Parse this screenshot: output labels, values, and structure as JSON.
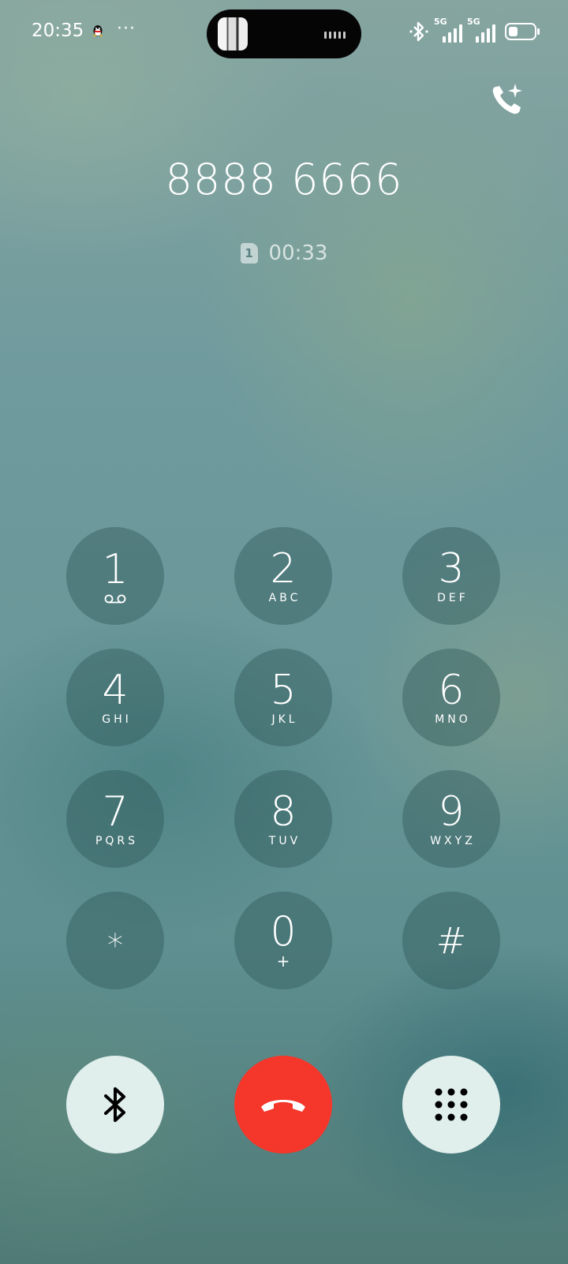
{
  "status_bar": {
    "time": "20:35",
    "more_indicator": "···",
    "network_1": "5G",
    "network_2": "5G",
    "battery_level": 0.35,
    "icons": [
      "qq-icon",
      "bluetooth-icon",
      "signal-icon",
      "battery-icon"
    ]
  },
  "call": {
    "number": "8888 6666",
    "sim_label": "1",
    "duration": "00:33"
  },
  "keypad": {
    "keys": [
      {
        "digit": "1",
        "letters": ""
      },
      {
        "digit": "2",
        "letters": "ABC"
      },
      {
        "digit": "3",
        "letters": "DEF"
      },
      {
        "digit": "4",
        "letters": "GHI"
      },
      {
        "digit": "5",
        "letters": "JKL"
      },
      {
        "digit": "6",
        "letters": "MNO"
      },
      {
        "digit": "7",
        "letters": "PQRS"
      },
      {
        "digit": "8",
        "letters": "TUV"
      },
      {
        "digit": "9",
        "letters": "WXYZ"
      },
      {
        "digit": "*",
        "letters": ""
      },
      {
        "digit": "0",
        "letters": "+"
      },
      {
        "digit": "#",
        "letters": ""
      }
    ]
  },
  "controls": {
    "left_icon": "bluetooth-icon",
    "center_icon": "end-call-icon",
    "right_icon": "keypad-icon",
    "end_color": "#f5362a"
  }
}
